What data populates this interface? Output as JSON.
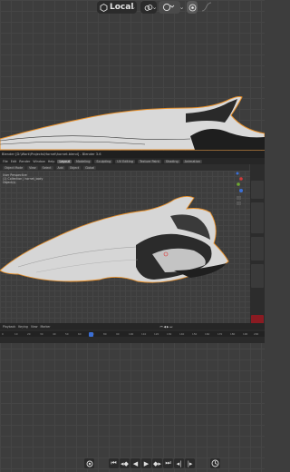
{
  "header": {
    "transform_orientation": "Local",
    "icons": [
      "object-mode-icon",
      "local-chevron-icon",
      "link-icon",
      "link-chevron-icon",
      "snap-icon",
      "snap-chevron-icon",
      "proportional-editing-icon",
      "falloff-icon"
    ]
  },
  "window": {
    "title": "Blender [D:\\Work\\Projects\\Hornet\\hornet.blend] - Blender 3.6"
  },
  "menubar": {
    "items": [
      "File",
      "Edit",
      "Render",
      "Window",
      "Help"
    ],
    "workspaces": [
      "Layout",
      "Modeling",
      "Sculpting",
      "UV Editing",
      "Texture Paint",
      "Shading",
      "Animation"
    ]
  },
  "viewport_header": {
    "items": [
      "Object Mode",
      "View",
      "Select",
      "Add",
      "Object",
      "Global"
    ]
  },
  "overlay": {
    "lines": [
      "User Perspective",
      "(1) Collection | hornet_body",
      "Object(s)"
    ]
  },
  "timeline": {
    "header_items": [
      "Playback",
      "Keying",
      "View",
      "Marker"
    ],
    "ruler_ticks": [
      "0",
      "10",
      "20",
      "30",
      "40",
      "50",
      "60",
      "70",
      "80",
      "90",
      "100",
      "110",
      "120",
      "130",
      "140",
      "150",
      "160",
      "170",
      "180",
      "190",
      "200"
    ]
  },
  "bottom_bar": {
    "icons": [
      "record-icon",
      "jump-start-icon",
      "prev-keyframe-icon",
      "play-reverse-icon",
      "play-icon",
      "next-keyframe-icon",
      "jump-end-icon",
      "frame-start-icon",
      "frame-end-icon",
      "playback-options-icon"
    ]
  },
  "colors": {
    "selection_outline": "#e8902a",
    "accent_blue": "#3b6fd6",
    "panel_red": "#8a1b22"
  }
}
